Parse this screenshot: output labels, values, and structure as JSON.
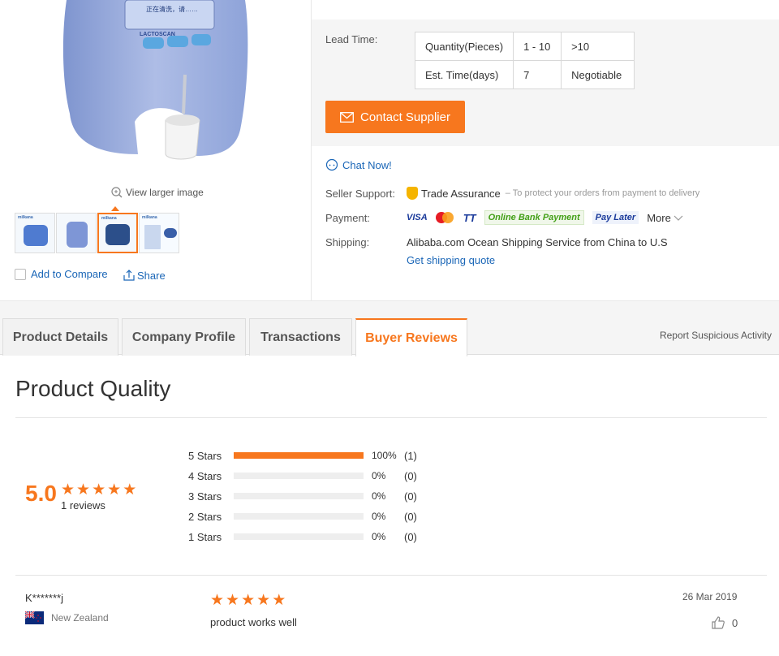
{
  "gallery": {
    "screen_text": "正在清洗，请……",
    "device_brand": "LACTOSCAN",
    "view_larger": "View larger image",
    "thumb_brand": "milkana",
    "add_to_compare": "Add to Compare",
    "share": "Share"
  },
  "lead_time": {
    "label": "Lead Time:",
    "rows": [
      {
        "head": "Quantity(Pieces)",
        "cells": [
          "1 - 10",
          ">10"
        ]
      },
      {
        "head": "Est. Time(days)",
        "cells": [
          "7",
          "Negotiable"
        ]
      }
    ]
  },
  "contact_supplier": "Contact Supplier",
  "chat_now": "Chat Now!",
  "seller_support": {
    "label": "Seller Support:",
    "value": "Trade Assurance",
    "note": "– To protect your orders from payment to delivery"
  },
  "payment": {
    "label": "Payment:",
    "methods": [
      "VISA",
      "TT",
      "Online Bank Payment",
      "Pay Later"
    ],
    "more": "More"
  },
  "shipping": {
    "label": "Shipping:",
    "value": "Alibaba.com Ocean Shipping Service from China to U.S",
    "quote_link": "Get shipping quote"
  },
  "tabs": [
    "Product Details",
    "Company Profile",
    "Transactions",
    "Buyer Reviews"
  ],
  "report": "Report Suspicious Activity",
  "quality": {
    "title": "Product Quality",
    "score": "5.0",
    "rating": 5,
    "reviews": "1 reviews",
    "distribution": [
      {
        "label": "5 Stars",
        "fraction": 1.0,
        "pct": "100%",
        "count": "(1)"
      },
      {
        "label": "4 Stars",
        "fraction": 0,
        "pct": "0%",
        "count": "(0)"
      },
      {
        "label": "3 Stars",
        "fraction": 0,
        "pct": "0%",
        "count": "(0)"
      },
      {
        "label": "2 Stars",
        "fraction": 0,
        "pct": "0%",
        "count": "(0)"
      },
      {
        "label": "1 Stars",
        "fraction": 0,
        "pct": "0%",
        "count": "(0)"
      }
    ]
  },
  "review": {
    "user": "K*******j",
    "country": "New Zealand",
    "rating": 5,
    "text": "product works well",
    "date": "26 Mar 2019",
    "likes": "0"
  },
  "colors": {
    "accent": "#f7771e",
    "link": "#1a66b7",
    "device": "#8fa6da"
  }
}
